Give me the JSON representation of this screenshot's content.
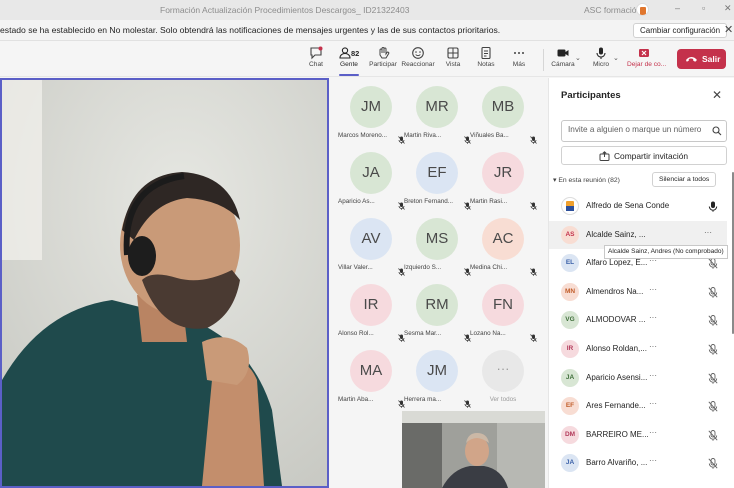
{
  "window": {
    "title": "Formación Actualización Procedimientos Descargos_ ID21322403",
    "org": "ASC formación",
    "minimize": "–",
    "maximize": "▫",
    "close": "✕"
  },
  "banner": {
    "message": "estado se ha establecido en No molestar. Solo obtendrá las notificaciones de mensajes urgentes y las de sus contactos prioritarios.",
    "button": "Cambiar configuración",
    "close": "✕"
  },
  "toolbar": {
    "chat": "Chat",
    "people": "Gente",
    "people_count": "82",
    "participate": "Participar",
    "react": "Reaccionar",
    "view": "Vista",
    "notes": "Notas",
    "more": "Más",
    "camera": "Cámara",
    "mic": "Micro",
    "share": "Dejar de co...",
    "leave": "Salir"
  },
  "gallery": {
    "tiles": [
      {
        "initials": "JM",
        "name": "Marcos Moreno...",
        "color": "#d8e6d4"
      },
      {
        "initials": "MR",
        "name": "Martin Riva...",
        "color": "#d8e6d4"
      },
      {
        "initials": "MB",
        "name": "Viñuales Ba...",
        "color": "#d8e6d4"
      },
      {
        "initials": "JA",
        "name": "Aparicio As...",
        "color": "#d8e6d4"
      },
      {
        "initials": "EF",
        "name": "Breton Fernand...",
        "color": "#dbe5f3"
      },
      {
        "initials": "JR",
        "name": "Martin Rasi...",
        "color": "#f6dade"
      },
      {
        "initials": "AV",
        "name": "Villar Valer...",
        "color": "#dbe5f3"
      },
      {
        "initials": "MS",
        "name": "Izquierdo S...",
        "color": "#d8e6d4"
      },
      {
        "initials": "AC",
        "name": "Medina Chi...",
        "color": "#f8ddd3"
      },
      {
        "initials": "IR",
        "name": "Alonso Rol...",
        "color": "#f6dade"
      },
      {
        "initials": "RM",
        "name": "Sesma Mar...",
        "color": "#d8e6d4"
      },
      {
        "initials": "FN",
        "name": "Lozano Na...",
        "color": "#f6dade"
      },
      {
        "initials": "MA",
        "name": "Martin Aba...",
        "color": "#f6dade"
      },
      {
        "initials": "JM",
        "name": "Herrera ma...",
        "color": "#dbe5f3"
      }
    ],
    "more_label": "Ver todos",
    "more_glyph": "···"
  },
  "panel": {
    "title": "Participantes",
    "close": "✕",
    "invite_placeholder": "Invite a alguien o marque un número",
    "share_invite": "Compartir invitación",
    "section": "En esta reunión (82)",
    "mute_all": "Silenciar a todos",
    "participants": [
      {
        "initials": "",
        "name": "Alfredo de Sena Conde",
        "mic": "on",
        "color": "#ffffff",
        "text": "#333333"
      },
      {
        "initials": "AS",
        "name": "Alcalde Sainz, ...",
        "mic": "off",
        "color": "#f8ddd3",
        "text": "#c4314b"
      },
      {
        "initials": "EL",
        "name": "Alfaro Lopez, E...",
        "mic": "off",
        "color": "#dbe5f3",
        "text": "#3a60a8"
      },
      {
        "initials": "MN",
        "name": "Almendros Na...",
        "mic": "off",
        "color": "#f8ddd3",
        "text": "#c15d2a"
      },
      {
        "initials": "VG",
        "name": "ALMODOVAR ...",
        "mic": "off",
        "color": "#d8e6d4",
        "text": "#3f6e3a"
      },
      {
        "initials": "IR",
        "name": "Alonso Roldan,...",
        "mic": "off",
        "color": "#f6dade",
        "text": "#b23a5a"
      },
      {
        "initials": "JA",
        "name": "Aparicio Asensi...",
        "mic": "off",
        "color": "#d8e6d4",
        "text": "#3f6e3a"
      },
      {
        "initials": "EF",
        "name": "Ares Fernande...",
        "mic": "off",
        "color": "#f8ddd3",
        "text": "#c15d2a"
      },
      {
        "initials": "DM",
        "name": "BARREIRO ME...",
        "mic": "off",
        "color": "#f6dade",
        "text": "#b23a5a"
      },
      {
        "initials": "JA",
        "name": "Barro Alvariño, ...",
        "mic": "off",
        "color": "#dbe5f3",
        "text": "#3a60a8"
      }
    ],
    "dots": "···",
    "tooltip": "Alcalde Sainz, Andres (No comprobado)"
  },
  "colors": {
    "accent": "#5b5fc7",
    "leave": "#c4314b"
  }
}
